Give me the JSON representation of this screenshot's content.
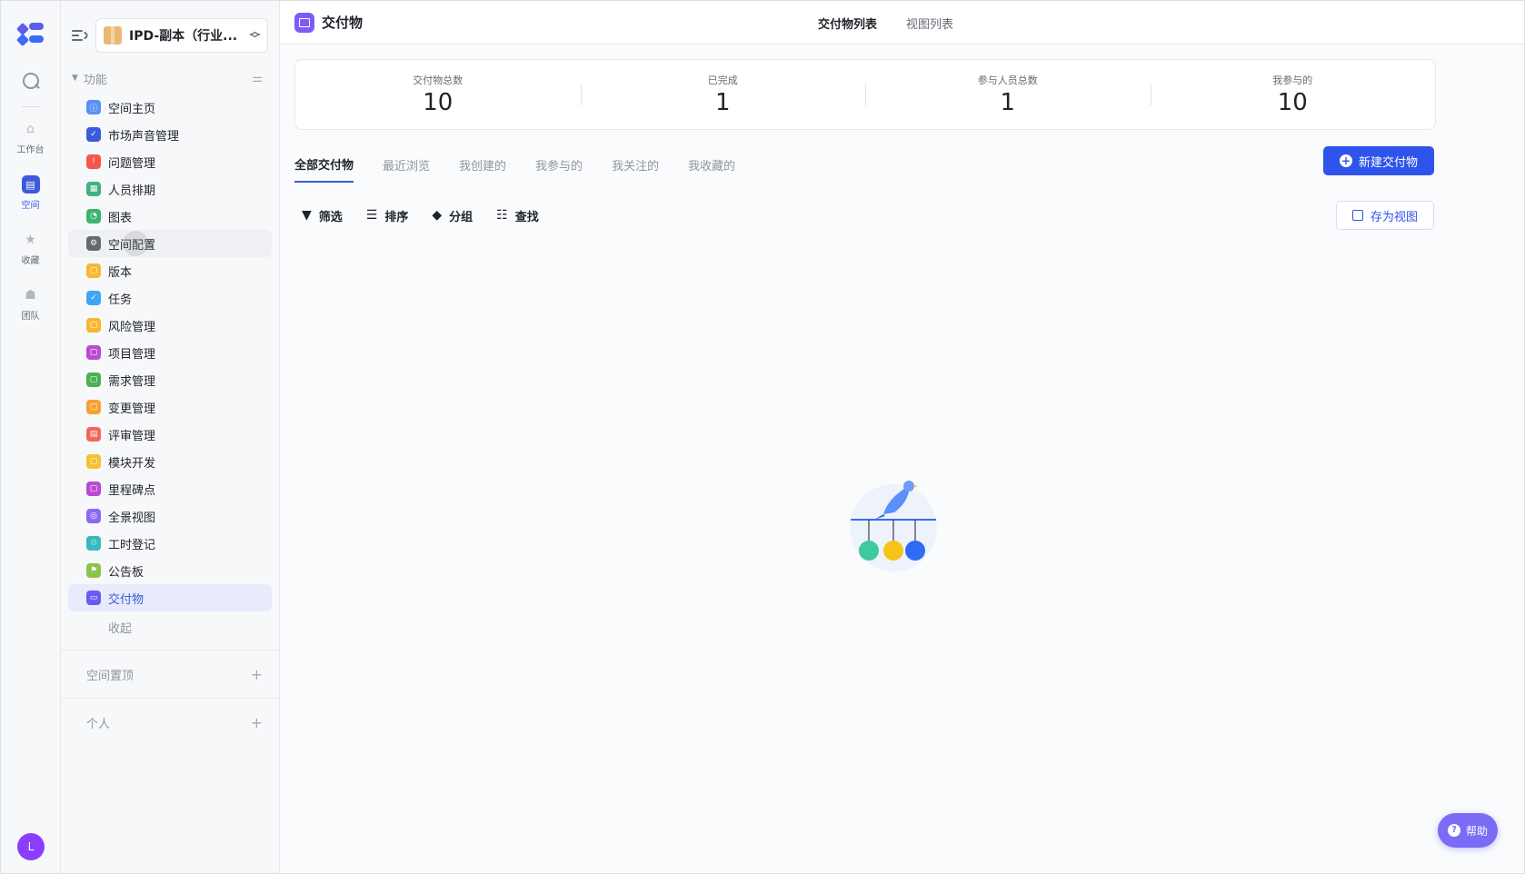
{
  "rail": {
    "items": [
      {
        "label": "工作台",
        "icon": "home-icon"
      },
      {
        "label": "空间",
        "icon": "space-icon"
      },
      {
        "label": "收藏",
        "icon": "star-icon"
      },
      {
        "label": "团队",
        "icon": "team-icon"
      }
    ],
    "avatar": "L"
  },
  "sidebar": {
    "space_name": "IPD-副本（行业...",
    "section_title": "功能",
    "items": [
      {
        "label": "空间主页",
        "color": "#5b8ff9",
        "glyph": "ⓘ"
      },
      {
        "label": "市场声音管理",
        "color": "#3b5bdb",
        "glyph": "✓"
      },
      {
        "label": "问题管理",
        "color": "#f5574b",
        "glyph": "!"
      },
      {
        "label": "人员排期",
        "color": "#3fb27f",
        "glyph": "▦"
      },
      {
        "label": "图表",
        "color": "#3cb371",
        "glyph": "◔"
      },
      {
        "label": "空间配置",
        "color": "#646a73",
        "glyph": "⚙"
      },
      {
        "label": "版本",
        "color": "#f7b733",
        "glyph": "▢"
      },
      {
        "label": "任务",
        "color": "#3ea6f5",
        "glyph": "✓"
      },
      {
        "label": "风险管理",
        "color": "#f7b733",
        "glyph": "▢"
      },
      {
        "label": "项目管理",
        "color": "#b94bd1",
        "glyph": "▢"
      },
      {
        "label": "需求管理",
        "color": "#4caf50",
        "glyph": "▢"
      },
      {
        "label": "变更管理",
        "color": "#f7a033",
        "glyph": "▢"
      },
      {
        "label": "评审管理",
        "color": "#f5655b",
        "glyph": "▤"
      },
      {
        "label": "模块开发",
        "color": "#f7c033",
        "glyph": "▢"
      },
      {
        "label": "里程碑点",
        "color": "#b94bd1",
        "glyph": "▢"
      },
      {
        "label": "全景视图",
        "color": "#8e67f5",
        "glyph": "◎"
      },
      {
        "label": "工时登记",
        "color": "#3ab8c0",
        "glyph": "♲"
      },
      {
        "label": "公告板",
        "color": "#8bc34a",
        "glyph": "⚑"
      },
      {
        "label": "交付物",
        "color": "#6a5cf0",
        "glyph": "▭"
      }
    ],
    "collapse_label": "收起",
    "pinned_title": "空间置顶",
    "personal_title": "个人"
  },
  "header": {
    "title": "交付物",
    "tabs": [
      "交付物列表",
      "视图列表"
    ]
  },
  "stats": [
    {
      "label": "交付物总数",
      "value": "10"
    },
    {
      "label": "已完成",
      "value": "1"
    },
    {
      "label": "参与人员总数",
      "value": "1"
    },
    {
      "label": "我参与的",
      "value": "10"
    }
  ],
  "subtabs": [
    "全部交付物",
    "最近浏览",
    "我创建的",
    "我参与的",
    "我关注的",
    "我收藏的"
  ],
  "new_button": "新建交付物",
  "toolbar": {
    "filter": "筛选",
    "sort": "排序",
    "group": "分组",
    "search": "查找",
    "save_view": "存为视图"
  },
  "help_label": "帮助",
  "colors": {
    "accent": "#2f54eb",
    "active_bg": "#e8ebfb"
  }
}
